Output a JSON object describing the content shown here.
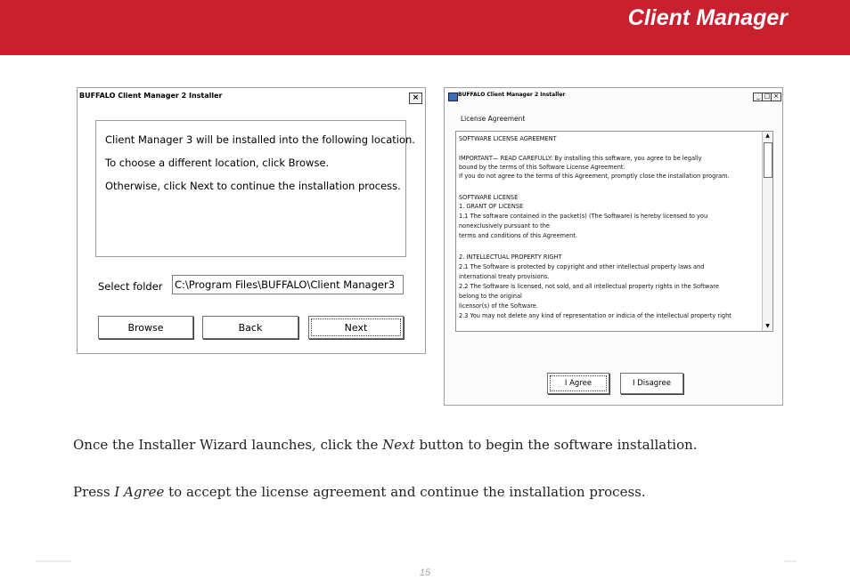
{
  "header": {
    "title": "Client Manager"
  },
  "installer": {
    "title": "BUFFALO Client Manager 2 Installer",
    "close": "×",
    "messages": [
      "Client Manager 3 will be installed into the following location.",
      "To choose a different location, click Browse.",
      "Otherwise, click Next to continue the installation process."
    ],
    "select_label": "Select folder",
    "folder_value": "C:\\Program Files\\BUFFALO\\Client Manager3",
    "buttons": {
      "browse": "Browse",
      "back": "Back",
      "next": "Next"
    }
  },
  "license": {
    "title": "BUFFALO Client Manager 2 Installer",
    "controls": {
      "minimize": "_",
      "maximize": "□",
      "close": "×"
    },
    "section_label": "License Agreement",
    "lines": [
      "SOFTWARE LICENSE AGREEMENT",
      "IMPORTANT— READ CAREFULLY: By installing this software, you agree to be legally",
      "bound by the terms of this Software License Agreement.",
      "If you do not agree to the terms of this Agreement, promptly close the installation program.",
      "SOFTWARE LICENSE",
      "1. GRANT OF LICENSE",
      "1.1 The software contained in the packet(s) (The Software) is hereby licensed to you",
      "nonexclusively pursuant to the",
      "terms and conditions of this Agreement.",
      "2. INTELLECTUAL PROPERTY RIGHT",
      "2.1 The Software is protected by copyright and other intellectual property laws and",
      "international treaty provisions.",
      "2.2 The Software is licensed, not sold, and all intellectual property rights in the Software",
      "belong to the original",
      "licensor(s) of the Software.",
      "2.3 You may not delete any kind of representation or indicia of the intellectual property right"
    ],
    "buttons": {
      "agree": "I Agree",
      "disagree": "I Disagree"
    }
  },
  "body": {
    "para1_before": "Once the Installer Wizard launches, click the ",
    "para1_em": "Next",
    "para1_after": " button to begin the software installation.",
    "para2_em": "I Agree",
    "para2_before": "Press ",
    "para2_after": " to accept the license agreement and continue the installation process."
  },
  "footer": {
    "page_number": "15"
  },
  "colors": {
    "header_red": "#c8202e"
  }
}
